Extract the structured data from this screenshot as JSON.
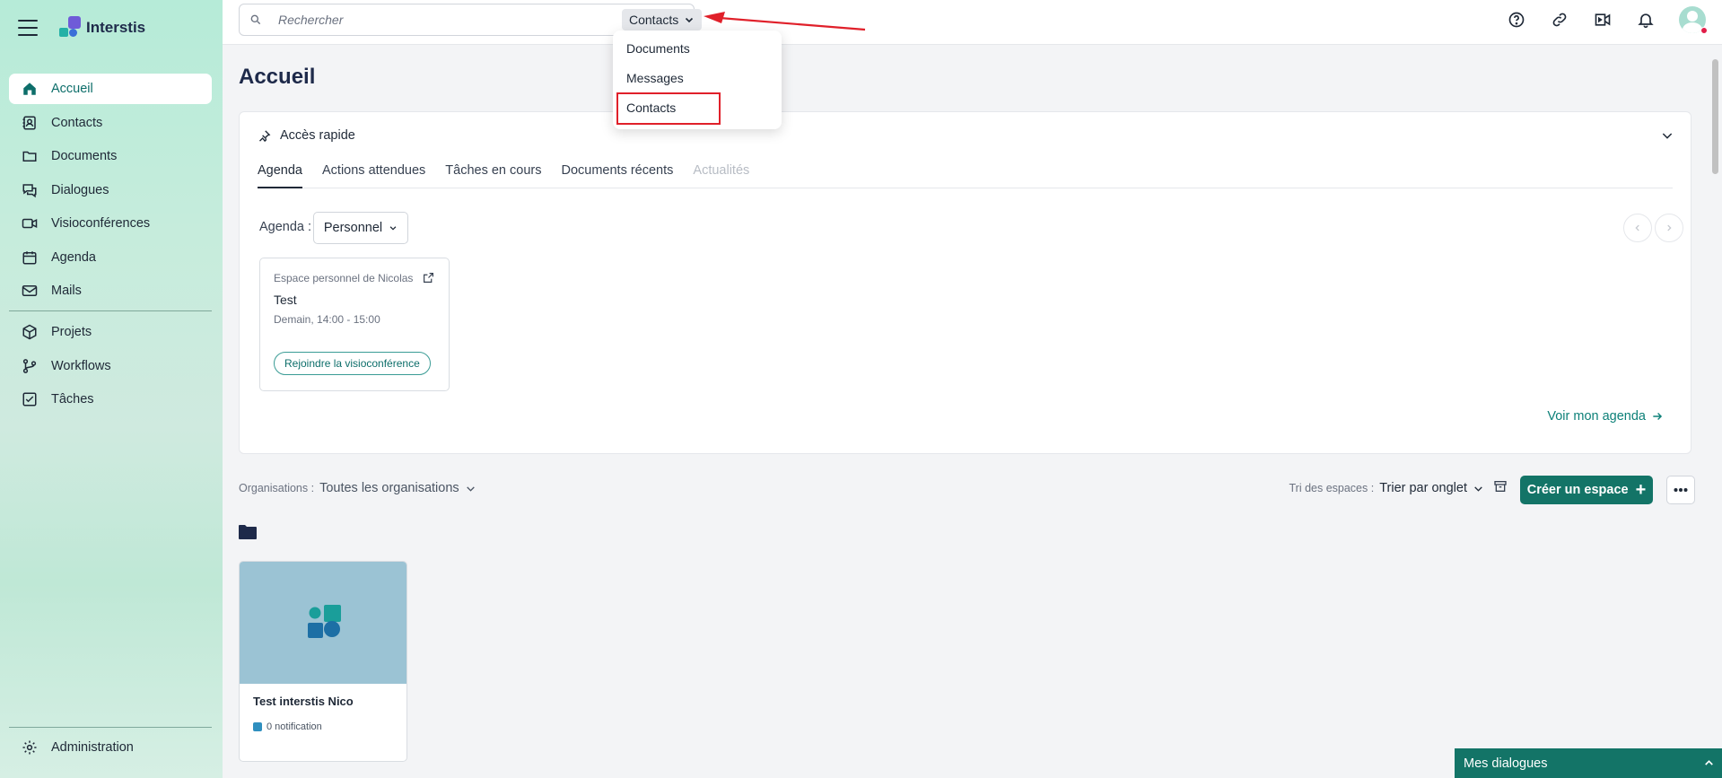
{
  "app": {
    "name": "Interstis"
  },
  "search": {
    "placeholder": "Rechercher",
    "scope": "Contacts"
  },
  "scope_menu": {
    "items": [
      "Documents",
      "Messages",
      "Contacts"
    ],
    "highlighted": "Contacts"
  },
  "sidebar": {
    "items": [
      {
        "label": "Accueil",
        "icon": "home-icon",
        "active": true
      },
      {
        "label": "Contacts",
        "icon": "contact-book-icon"
      },
      {
        "label": "Documents",
        "icon": "folder-icon"
      },
      {
        "label": "Dialogues",
        "icon": "chat-icon"
      },
      {
        "label": "Visioconférences",
        "icon": "video-icon"
      },
      {
        "label": "Agenda",
        "icon": "calendar-icon"
      },
      {
        "label": "Mails",
        "icon": "mail-icon"
      },
      {
        "label": "Projets",
        "icon": "cube-icon"
      },
      {
        "label": "Workflows",
        "icon": "workflow-icon"
      },
      {
        "label": "Tâches",
        "icon": "checkbox-icon"
      }
    ],
    "admin": {
      "label": "Administration",
      "icon": "gear-icon"
    }
  },
  "topbar": {
    "icons": [
      "help-icon",
      "link-icon",
      "video-share-icon",
      "bell-icon",
      "avatar"
    ]
  },
  "page": {
    "title": "Accueil"
  },
  "quick_access": {
    "title": "Accès rapide",
    "tabs": [
      "Agenda",
      "Actions attendues",
      "Tâches en cours",
      "Documents récents",
      "Actualités"
    ],
    "active_tab": "Agenda",
    "agenda_label": "Agenda :",
    "agenda_select": "Personnel",
    "event": {
      "space": "Espace personnel de Nicolas",
      "title": "Test",
      "time": "Demain, 14:00 - 15:00",
      "join_label": "Rejoindre la visioconférence"
    },
    "see_agenda": "Voir mon agenda"
  },
  "filters": {
    "org_label": "Organisations :",
    "org_value": "Toutes les organisations",
    "sort_label": "Tri des espaces :",
    "sort_value": "Trier par onglet",
    "create_label": "Créer un espace"
  },
  "spaces": [
    {
      "name": "Test interstis Nico",
      "notification": "0 notification"
    }
  ],
  "dialogs_bar": {
    "label": "Mes dialogues"
  },
  "colors": {
    "accent": "#137467",
    "sidebar": "#c6ecdc",
    "highlight": "#e0202a"
  }
}
